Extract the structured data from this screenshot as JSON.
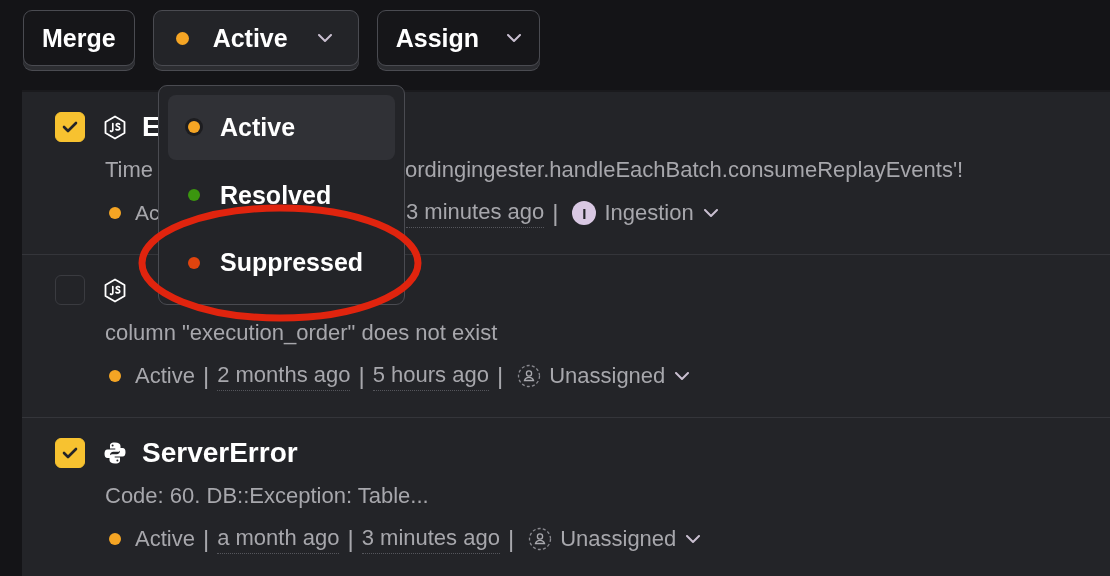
{
  "toolbar": {
    "merge_button": "Merge",
    "status_button": {
      "label": "Active",
      "color": "#f5a524"
    },
    "assign_button": "Assign"
  },
  "status_menu": {
    "items": [
      {
        "label": "Active",
        "color": "#f5a524",
        "selected": true
      },
      {
        "label": "Resolved",
        "color": "#3b960f",
        "selected": false
      },
      {
        "label": "Suppressed",
        "color": "#e0440e",
        "selected": false
      }
    ]
  },
  "issues": [
    {
      "checked": true,
      "kind": "js",
      "title": "E",
      "description": [
        "Time",
        "ordingingester.handleEachBatch.consumeReplayEvents'!"
      ],
      "meta": [
        [
          {
            "kind": "status",
            "label": "Ac",
            "color": "#f5a524"
          }
        ],
        [
          {
            "kind": "time",
            "text": "3 minutes ago"
          },
          {
            "kind": "sep",
            "text": "|"
          },
          {
            "kind": "team",
            "initial": "I",
            "label": "Ingestion"
          }
        ]
      ]
    },
    {
      "checked": false,
      "kind": "js",
      "description": [
        "column \"execution_order\" does not exist"
      ],
      "meta": [
        [
          {
            "kind": "status",
            "label": "Active",
            "color": "#f5a524"
          },
          {
            "kind": "sep",
            "text": "|"
          },
          {
            "kind": "time",
            "text": "2 months ago"
          },
          {
            "kind": "sep",
            "text": "|"
          },
          {
            "kind": "time",
            "text": "5 hours ago"
          },
          {
            "kind": "sep",
            "text": "|"
          },
          {
            "kind": "unassigned",
            "label": "Unassigned"
          }
        ]
      ]
    },
    {
      "checked": true,
      "kind": "python",
      "title": "ServerError",
      "description": [
        "Code: 60. DB::Exception: Table..."
      ],
      "meta": [
        [
          {
            "kind": "status",
            "label": "Active",
            "color": "#f5a524"
          },
          {
            "kind": "sep",
            "text": "|"
          },
          {
            "kind": "time",
            "text": "a month ago"
          },
          {
            "kind": "sep",
            "text": "|"
          },
          {
            "kind": "time",
            "text": "3 minutes ago"
          },
          {
            "kind": "sep",
            "text": "|"
          },
          {
            "kind": "unassigned",
            "label": "Unassigned"
          }
        ]
      ]
    }
  ]
}
